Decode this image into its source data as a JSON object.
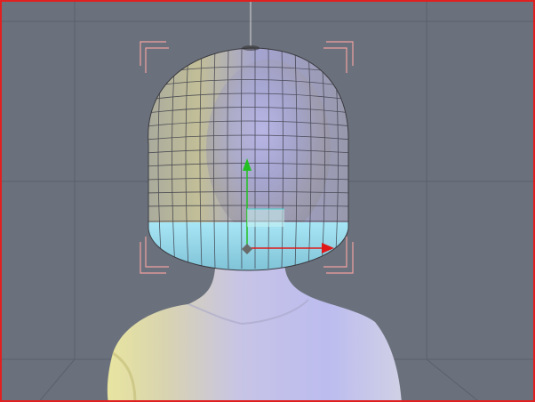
{
  "viewport": {
    "border_color": "#e02020",
    "background_color": "#6b717c",
    "grid_color": "#59606c",
    "caption": ""
  },
  "scene": {
    "selection_bracket_color": "#f0a0a0",
    "head_proxy_color": "#b8b9de",
    "head_proxy_lower_color": "#8fd3e7",
    "figure_skin_color": "#d9d4e8"
  },
  "gizmo": {
    "y_axis_color": "#22c022",
    "x_axis_color": "#e01818",
    "z_axis_color": "#4ed0d0",
    "origin_color": "#6a6a6a"
  },
  "icons": {
    "translate_gizmo": "translate-gizmo-icon",
    "selection_brackets": "selection-bracket-icon"
  }
}
